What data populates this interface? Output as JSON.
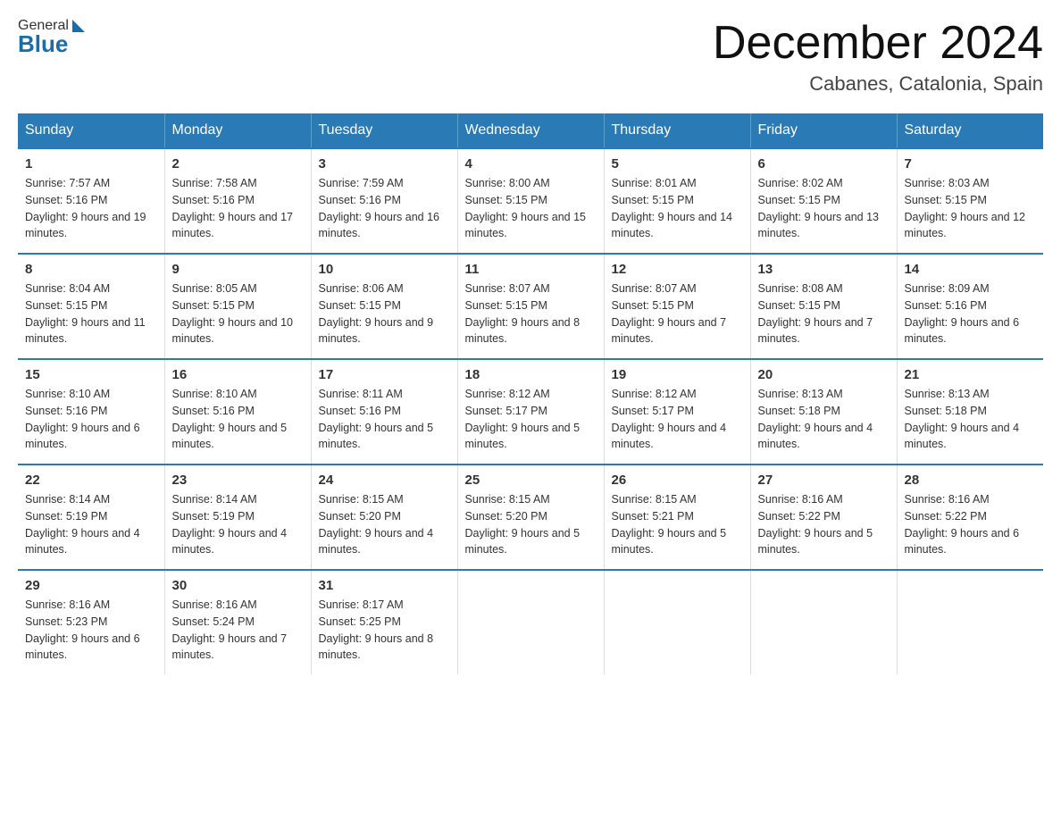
{
  "header": {
    "logo_general": "General",
    "logo_blue": "Blue",
    "title": "December 2024",
    "subtitle": "Cabanes, Catalonia, Spain"
  },
  "days_of_week": [
    "Sunday",
    "Monday",
    "Tuesday",
    "Wednesday",
    "Thursday",
    "Friday",
    "Saturday"
  ],
  "weeks": [
    [
      {
        "day": "1",
        "sunrise": "7:57 AM",
        "sunset": "5:16 PM",
        "daylight": "9 hours and 19 minutes."
      },
      {
        "day": "2",
        "sunrise": "7:58 AM",
        "sunset": "5:16 PM",
        "daylight": "9 hours and 17 minutes."
      },
      {
        "day": "3",
        "sunrise": "7:59 AM",
        "sunset": "5:16 PM",
        "daylight": "9 hours and 16 minutes."
      },
      {
        "day": "4",
        "sunrise": "8:00 AM",
        "sunset": "5:15 PM",
        "daylight": "9 hours and 15 minutes."
      },
      {
        "day": "5",
        "sunrise": "8:01 AM",
        "sunset": "5:15 PM",
        "daylight": "9 hours and 14 minutes."
      },
      {
        "day": "6",
        "sunrise": "8:02 AM",
        "sunset": "5:15 PM",
        "daylight": "9 hours and 13 minutes."
      },
      {
        "day": "7",
        "sunrise": "8:03 AM",
        "sunset": "5:15 PM",
        "daylight": "9 hours and 12 minutes."
      }
    ],
    [
      {
        "day": "8",
        "sunrise": "8:04 AM",
        "sunset": "5:15 PM",
        "daylight": "9 hours and 11 minutes."
      },
      {
        "day": "9",
        "sunrise": "8:05 AM",
        "sunset": "5:15 PM",
        "daylight": "9 hours and 10 minutes."
      },
      {
        "day": "10",
        "sunrise": "8:06 AM",
        "sunset": "5:15 PM",
        "daylight": "9 hours and 9 minutes."
      },
      {
        "day": "11",
        "sunrise": "8:07 AM",
        "sunset": "5:15 PM",
        "daylight": "9 hours and 8 minutes."
      },
      {
        "day": "12",
        "sunrise": "8:07 AM",
        "sunset": "5:15 PM",
        "daylight": "9 hours and 7 minutes."
      },
      {
        "day": "13",
        "sunrise": "8:08 AM",
        "sunset": "5:15 PM",
        "daylight": "9 hours and 7 minutes."
      },
      {
        "day": "14",
        "sunrise": "8:09 AM",
        "sunset": "5:16 PM",
        "daylight": "9 hours and 6 minutes."
      }
    ],
    [
      {
        "day": "15",
        "sunrise": "8:10 AM",
        "sunset": "5:16 PM",
        "daylight": "9 hours and 6 minutes."
      },
      {
        "day": "16",
        "sunrise": "8:10 AM",
        "sunset": "5:16 PM",
        "daylight": "9 hours and 5 minutes."
      },
      {
        "day": "17",
        "sunrise": "8:11 AM",
        "sunset": "5:16 PM",
        "daylight": "9 hours and 5 minutes."
      },
      {
        "day": "18",
        "sunrise": "8:12 AM",
        "sunset": "5:17 PM",
        "daylight": "9 hours and 5 minutes."
      },
      {
        "day": "19",
        "sunrise": "8:12 AM",
        "sunset": "5:17 PM",
        "daylight": "9 hours and 4 minutes."
      },
      {
        "day": "20",
        "sunrise": "8:13 AM",
        "sunset": "5:18 PM",
        "daylight": "9 hours and 4 minutes."
      },
      {
        "day": "21",
        "sunrise": "8:13 AM",
        "sunset": "5:18 PM",
        "daylight": "9 hours and 4 minutes."
      }
    ],
    [
      {
        "day": "22",
        "sunrise": "8:14 AM",
        "sunset": "5:19 PM",
        "daylight": "9 hours and 4 minutes."
      },
      {
        "day": "23",
        "sunrise": "8:14 AM",
        "sunset": "5:19 PM",
        "daylight": "9 hours and 4 minutes."
      },
      {
        "day": "24",
        "sunrise": "8:15 AM",
        "sunset": "5:20 PM",
        "daylight": "9 hours and 4 minutes."
      },
      {
        "day": "25",
        "sunrise": "8:15 AM",
        "sunset": "5:20 PM",
        "daylight": "9 hours and 5 minutes."
      },
      {
        "day": "26",
        "sunrise": "8:15 AM",
        "sunset": "5:21 PM",
        "daylight": "9 hours and 5 minutes."
      },
      {
        "day": "27",
        "sunrise": "8:16 AM",
        "sunset": "5:22 PM",
        "daylight": "9 hours and 5 minutes."
      },
      {
        "day": "28",
        "sunrise": "8:16 AM",
        "sunset": "5:22 PM",
        "daylight": "9 hours and 6 minutes."
      }
    ],
    [
      {
        "day": "29",
        "sunrise": "8:16 AM",
        "sunset": "5:23 PM",
        "daylight": "9 hours and 6 minutes."
      },
      {
        "day": "30",
        "sunrise": "8:16 AM",
        "sunset": "5:24 PM",
        "daylight": "9 hours and 7 minutes."
      },
      {
        "day": "31",
        "sunrise": "8:17 AM",
        "sunset": "5:25 PM",
        "daylight": "9 hours and 8 minutes."
      },
      null,
      null,
      null,
      null
    ]
  ]
}
